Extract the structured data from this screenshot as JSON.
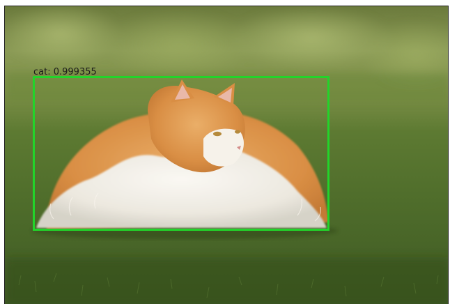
{
  "detection": {
    "label_text": "cat: 0.999355",
    "class_name": "cat",
    "confidence": 0.999355,
    "box_color": "#22d42a"
  },
  "scene": {
    "subject": "cat",
    "cat_colors": [
      "#e3a05a",
      "#f3efe8"
    ],
    "background": "grass-and-shrubs"
  }
}
